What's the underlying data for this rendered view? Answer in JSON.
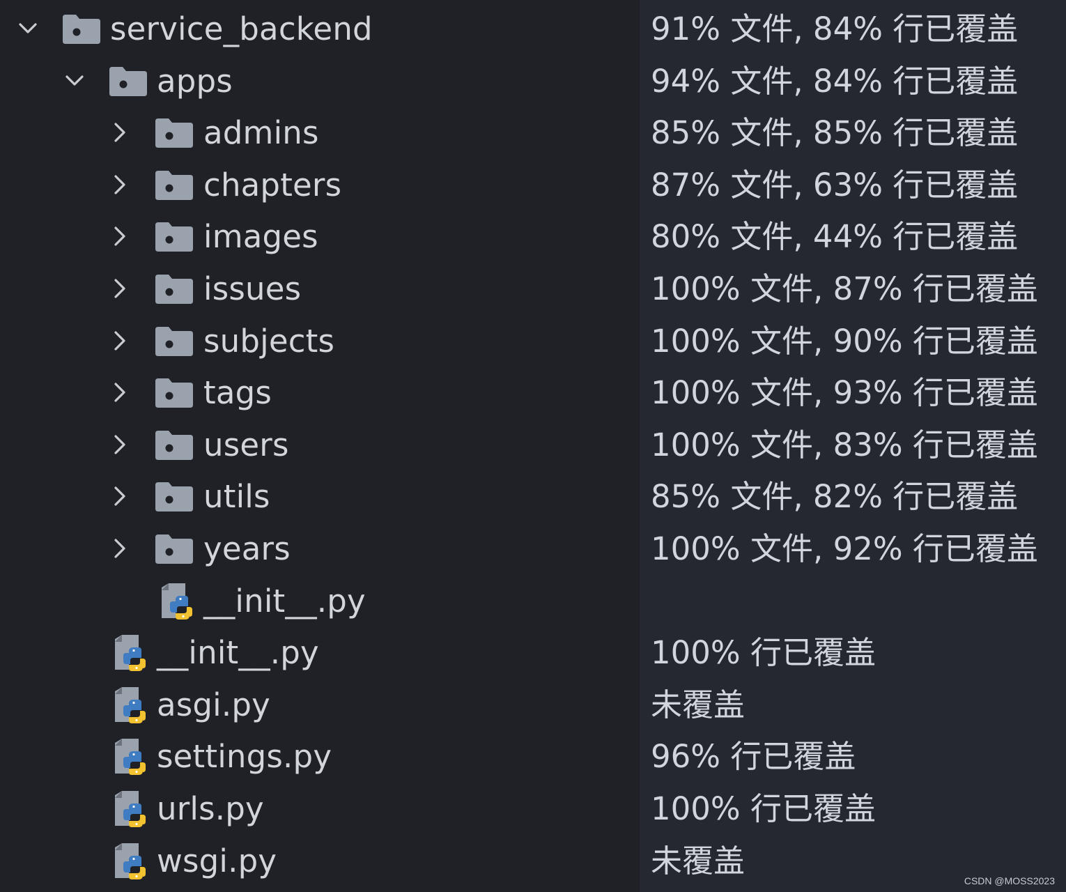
{
  "tree": {
    "root": {
      "name": "service_backend",
      "coverage": "91% 文件, 84% 行已覆盖",
      "expanded": true,
      "icon": "folder-icon"
    },
    "apps": {
      "name": "apps",
      "coverage": "94% 文件, 84% 行已覆盖",
      "expanded": true,
      "icon": "folder-icon"
    },
    "folders": [
      {
        "name": "admins",
        "coverage": "85% 文件, 85% 行已覆盖",
        "icon": "folder-icon"
      },
      {
        "name": "chapters",
        "coverage": "87% 文件, 63% 行已覆盖",
        "icon": "folder-icon"
      },
      {
        "name": "images",
        "coverage": "80% 文件, 44% 行已覆盖",
        "icon": "folder-icon"
      },
      {
        "name": "issues",
        "coverage": "100% 文件, 87% 行已覆盖",
        "icon": "folder-icon"
      },
      {
        "name": "subjects",
        "coverage": "100% 文件, 90% 行已覆盖",
        "icon": "folder-icon"
      },
      {
        "name": "tags",
        "coverage": "100% 文件, 93% 行已覆盖",
        "icon": "folder-icon"
      },
      {
        "name": "users",
        "coverage": "100% 文件, 83% 行已覆盖",
        "icon": "folder-icon"
      },
      {
        "name": "utils",
        "coverage": "85% 文件, 82% 行已覆盖",
        "icon": "folder-icon"
      },
      {
        "name": "years",
        "coverage": "100% 文件, 92% 行已覆盖",
        "icon": "folder-icon"
      }
    ],
    "apps_init": {
      "name": "__init__.py",
      "coverage": "",
      "icon": "python-file-icon"
    },
    "files": [
      {
        "name": "__init__.py",
        "coverage": "100% 行已覆盖",
        "icon": "python-file-icon"
      },
      {
        "name": "asgi.py",
        "coverage": "未覆盖",
        "icon": "python-file-icon"
      },
      {
        "name": "settings.py",
        "coverage": "96% 行已覆盖",
        "icon": "python-file-icon"
      },
      {
        "name": "urls.py",
        "coverage": "100% 行已覆盖",
        "icon": "python-file-icon"
      },
      {
        "name": "wsgi.py",
        "coverage": "未覆盖",
        "icon": "python-file-icon"
      }
    ]
  },
  "watermark": "CSDN @MOSS2023",
  "colors": {
    "background": "#1f2127",
    "coverage_background": "#252830",
    "text": "#d2d5db",
    "folder": "#9aa3ad",
    "python_blue": "#3f7cc2",
    "python_yellow": "#f2c230"
  }
}
